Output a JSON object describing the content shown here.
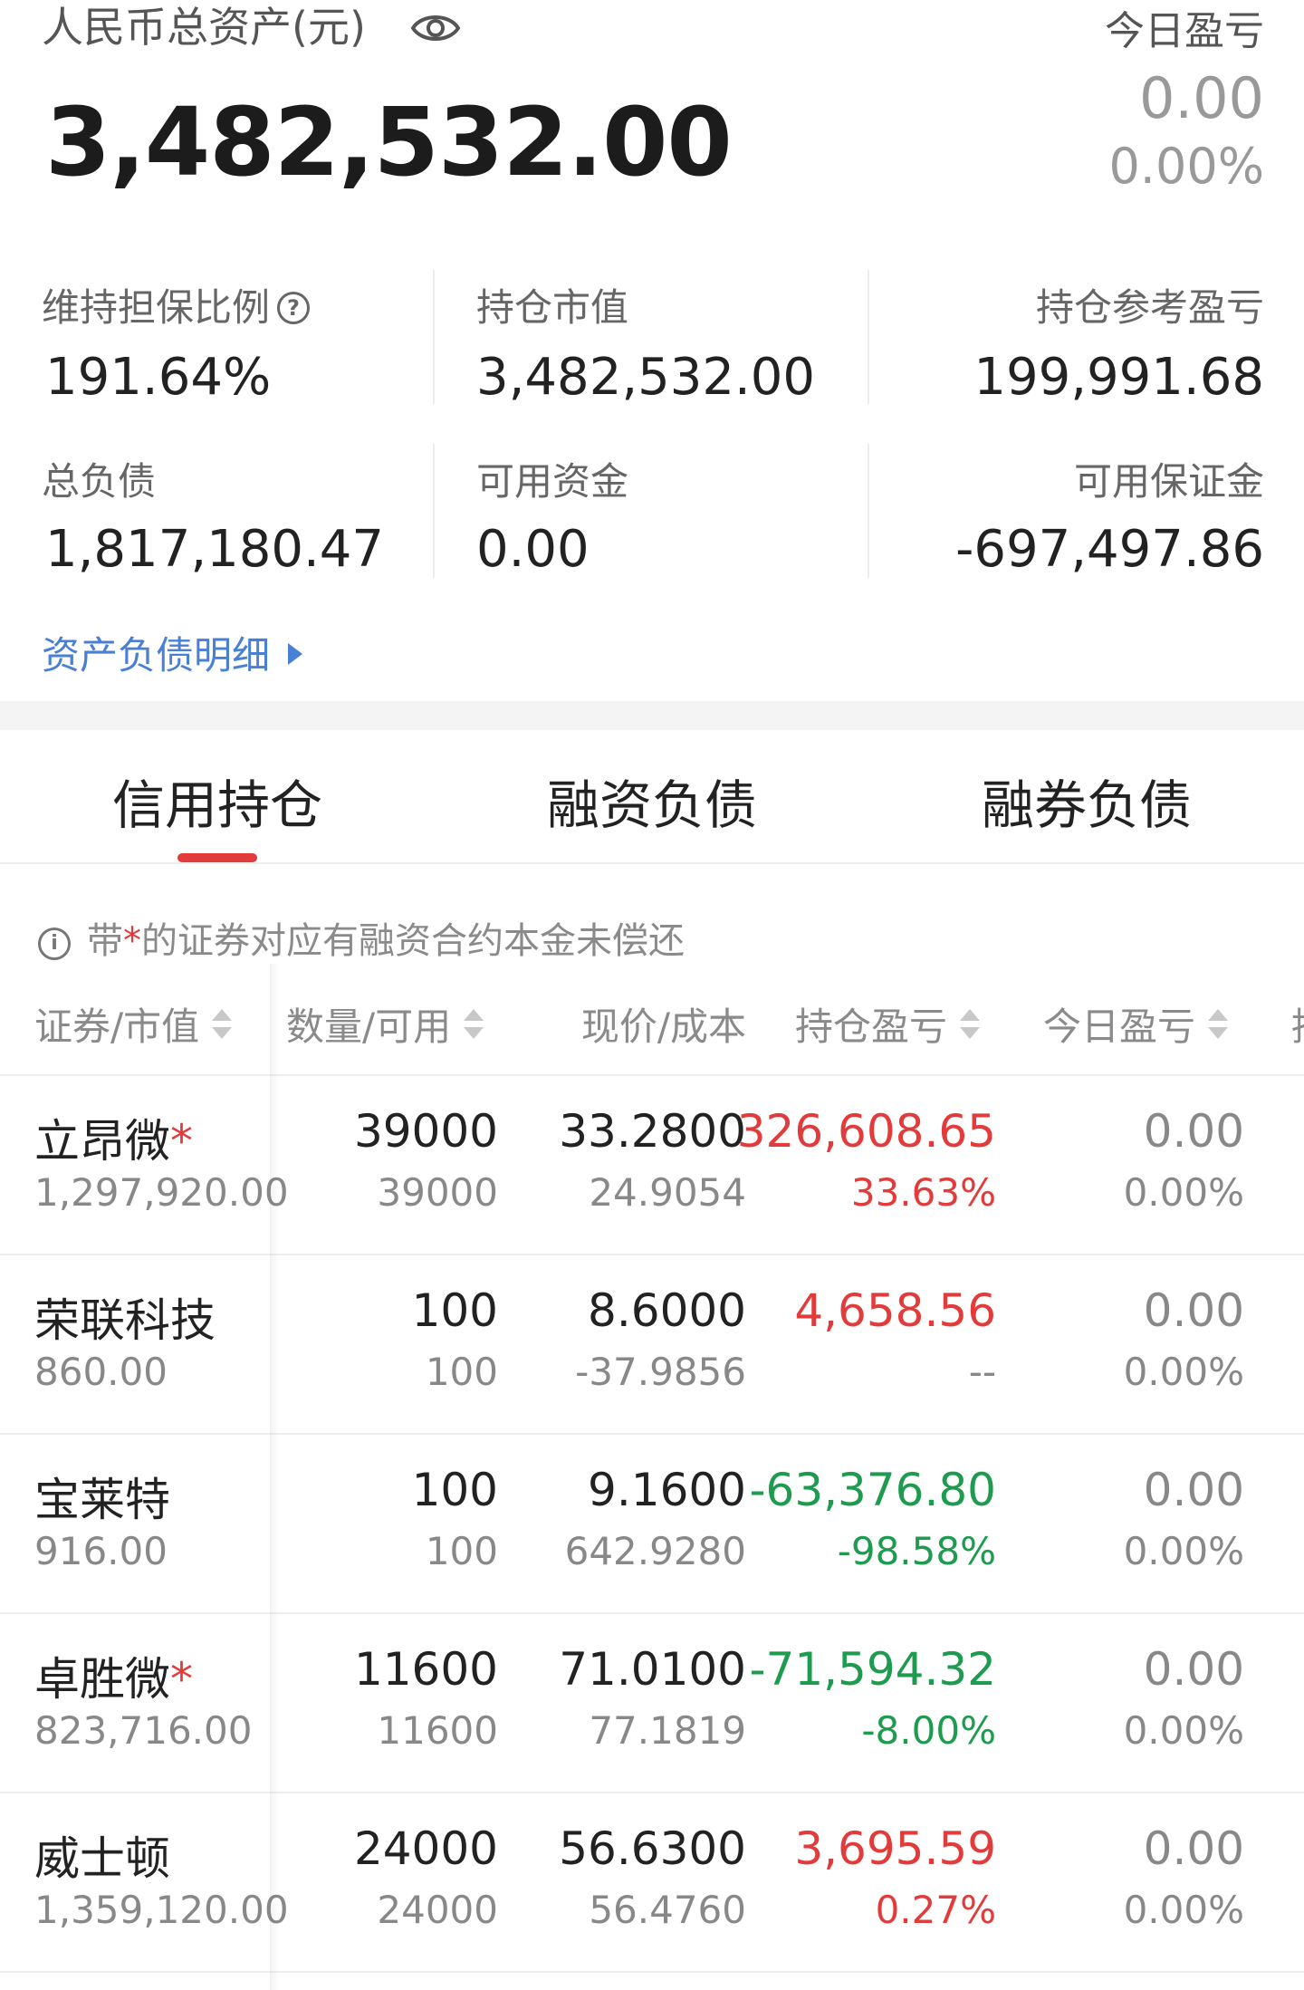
{
  "header": {
    "total_label": "人民币总资产(元)",
    "total_value": "3,482,532.00",
    "today_label": "今日盈亏",
    "today_value": "0.00",
    "today_pct": "0.00%"
  },
  "metrics": {
    "maintenance_ratio_label": "维持担保比例",
    "maintenance_ratio_value": "191.64%",
    "position_value_label": "持仓市值",
    "position_value_value": "3,482,532.00",
    "position_pl_label": "持仓参考盈亏",
    "position_pl_value": "199,991.68",
    "total_liability_label": "总负债",
    "total_liability_value": "1,817,180.47",
    "available_funds_label": "可用资金",
    "available_funds_value": "0.00",
    "available_margin_label": "可用保证金",
    "available_margin_value": "-697,497.86"
  },
  "detail_link": "资产负债明细",
  "tabs": [
    {
      "label": "信用持仓",
      "active": true
    },
    {
      "label": "融资负债",
      "active": false
    },
    {
      "label": "融券负债",
      "active": false
    }
  ],
  "notice": {
    "prefix": "带",
    "star": "*",
    "suffix": "的证券对应有融资合约本金未偿还"
  },
  "columns": {
    "security": "证券/市值",
    "qty": "数量/可用",
    "price": "现价/成本",
    "position_pl": "持仓盈亏",
    "today_pl": "今日盈亏",
    "cut": "持"
  },
  "rows": [
    {
      "name": "立昂微",
      "star": "*",
      "market_value": "1,297,920.00",
      "qty": "39000",
      "avail": "39000",
      "price": "33.2800",
      "cost": "24.9054",
      "pl": "326,608.65",
      "pl_pct": "33.63%",
      "pl_color": "#e23b3b",
      "today": "0.00",
      "today_pct": "0.00%"
    },
    {
      "name": "荣联科技",
      "star": "",
      "market_value": "860.00",
      "qty": "100",
      "avail": "100",
      "price": "8.6000",
      "cost": "-37.9856",
      "pl": "4,658.56",
      "pl_pct": "--",
      "pl_color": "#e23b3b",
      "today": "0.00",
      "today_pct": "0.00%"
    },
    {
      "name": "宝莱特",
      "star": "",
      "market_value": "916.00",
      "qty": "100",
      "avail": "100",
      "price": "9.1600",
      "cost": "642.9280",
      "pl": "-63,376.80",
      "pl_pct": "-98.58%",
      "pl_color": "#1e9b4f",
      "today": "0.00",
      "today_pct": "0.00%"
    },
    {
      "name": "卓胜微",
      "star": "*",
      "market_value": "823,716.00",
      "qty": "11600",
      "avail": "11600",
      "price": "71.0100",
      "cost": "77.1819",
      "pl": "-71,594.32",
      "pl_pct": "-8.00%",
      "pl_color": "#1e9b4f",
      "today": "0.00",
      "today_pct": "0.00%"
    },
    {
      "name": "威士顿",
      "star": "",
      "market_value": "1,359,120.00",
      "qty": "24000",
      "avail": "24000",
      "price": "56.6300",
      "cost": "56.4760",
      "pl": "3,695.59",
      "pl_pct": "0.27%",
      "pl_color": "#e23b3b",
      "today": "0.00",
      "today_pct": "0.00%"
    }
  ]
}
